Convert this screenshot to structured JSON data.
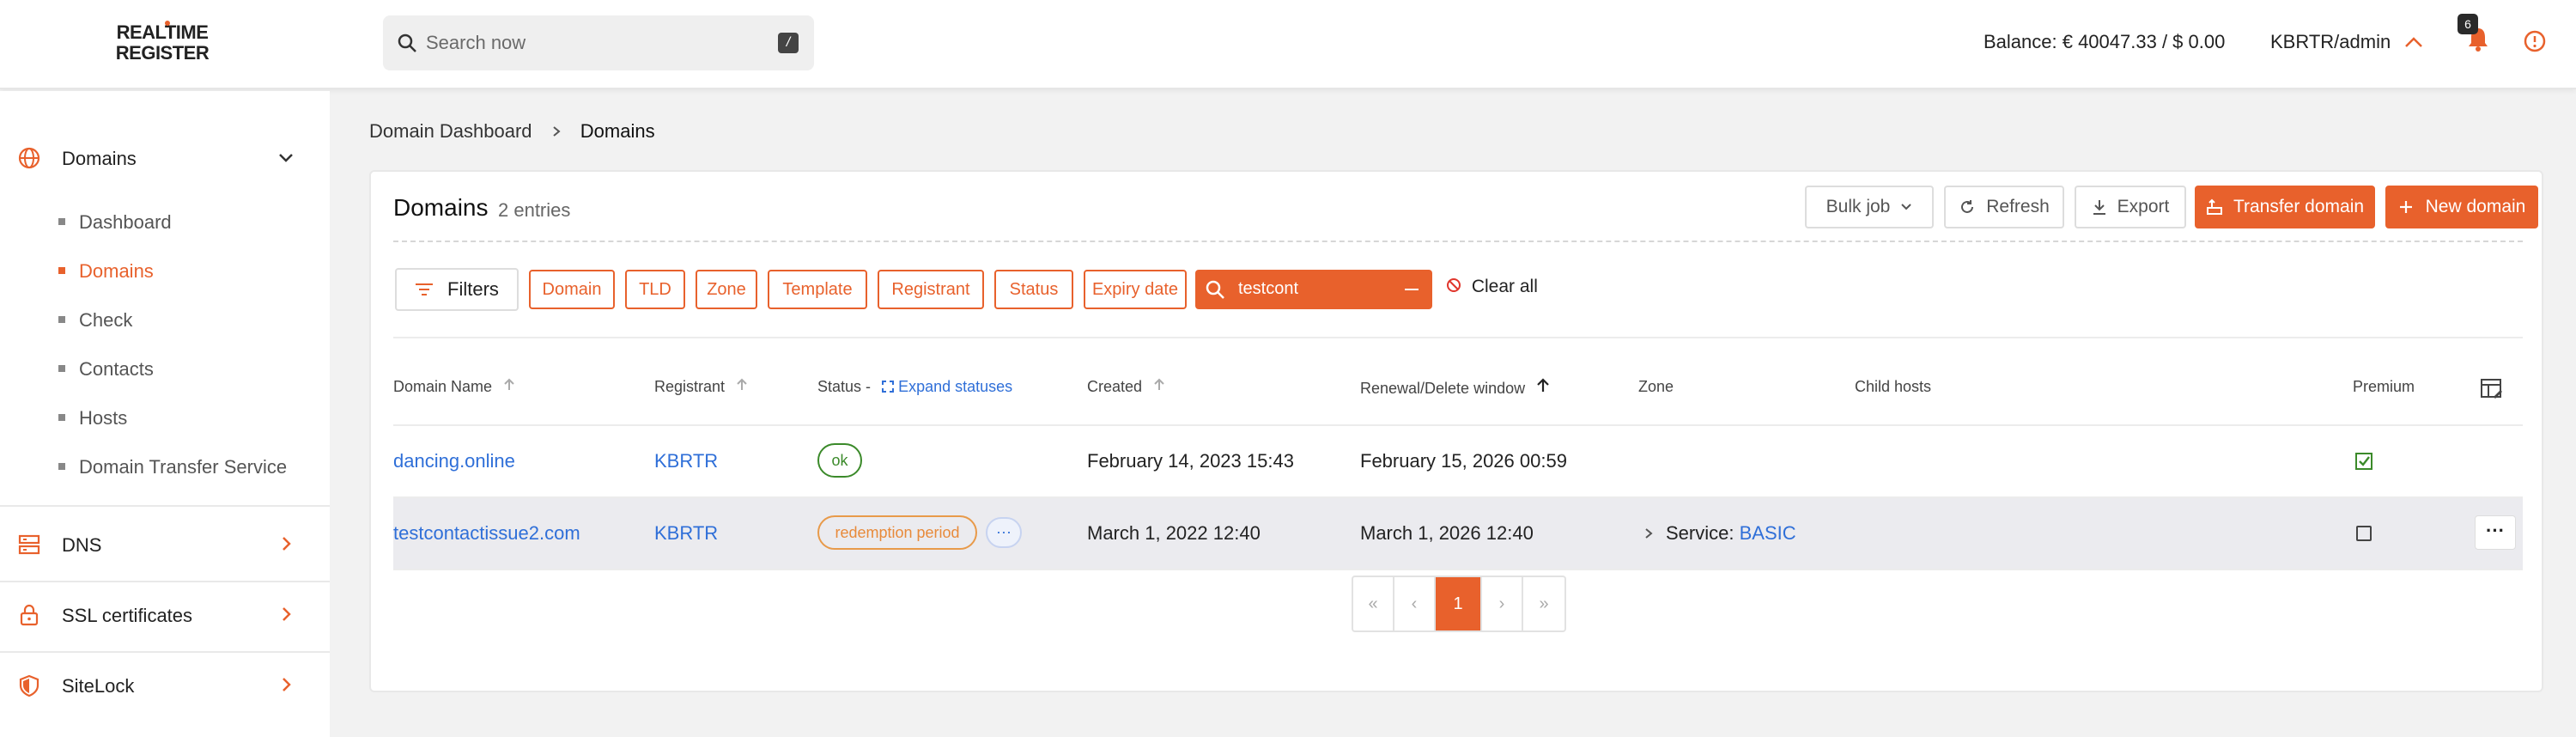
{
  "header": {
    "logo_line1": "REALTIME",
    "logo_line2": "REGISTER",
    "search_placeholder": "Search now",
    "search_shortcut": "/",
    "balance": "Balance: € 40047.33 / $ 0.00",
    "account": "KBRTR/admin",
    "notification_count": "6"
  },
  "sidebar": {
    "domains_label": "Domains",
    "sub_items": [
      {
        "label": "Dashboard"
      },
      {
        "label": "Domains"
      },
      {
        "label": "Check"
      },
      {
        "label": "Contacts"
      },
      {
        "label": "Hosts"
      },
      {
        "label": "Domain Transfer Service"
      }
    ],
    "sections": [
      {
        "label": "DNS"
      },
      {
        "label": "SSL certificates"
      },
      {
        "label": "SiteLock"
      }
    ]
  },
  "breadcrumb": {
    "parent": "Domain Dashboard",
    "current": "Domains"
  },
  "card": {
    "title": "Domains",
    "count": "2 entries",
    "buttons": {
      "bulk": "Bulk job",
      "refresh": "Refresh",
      "export": "Export",
      "transfer": "Transfer domain",
      "new": "New domain"
    },
    "filters_label": "Filters",
    "filter_chips": [
      "Domain",
      "TLD",
      "Zone",
      "Template",
      "Registrant",
      "Status",
      "Expiry date"
    ],
    "search_value": "testcont",
    "clear_all": "Clear all"
  },
  "table": {
    "headers": {
      "domain": "Domain Name",
      "registrant": "Registrant",
      "status": "Status -",
      "expand": "Expand statuses",
      "created": "Created",
      "renewal": "Renewal/Delete window",
      "zone": "Zone",
      "child_hosts": "Child hosts",
      "premium": "Premium"
    },
    "rows": [
      {
        "domain": "dancing.online",
        "registrant": "KBRTR",
        "status": "ok",
        "created": "February 14, 2023 15:43",
        "renewal": "February 15, 2026 00:59",
        "zone_label": "",
        "zone_value": "",
        "premium_checked": true
      },
      {
        "domain": "testcontactissue2.com",
        "registrant": "KBRTR",
        "status": "redemption period",
        "more": "···",
        "created": "March 1, 2022 12:40",
        "renewal": "March 1, 2026 12:40",
        "zone_label": "Service:",
        "zone_value": "BASIC",
        "premium_checked": false,
        "actions": "···"
      }
    ]
  },
  "pagination": {
    "first": "«",
    "prev": "‹",
    "page": "1",
    "next": "›",
    "last": "»"
  },
  "colors": {
    "accent": "#e8612c",
    "link": "#2f6fd8",
    "ok": "#3b8a2a"
  }
}
